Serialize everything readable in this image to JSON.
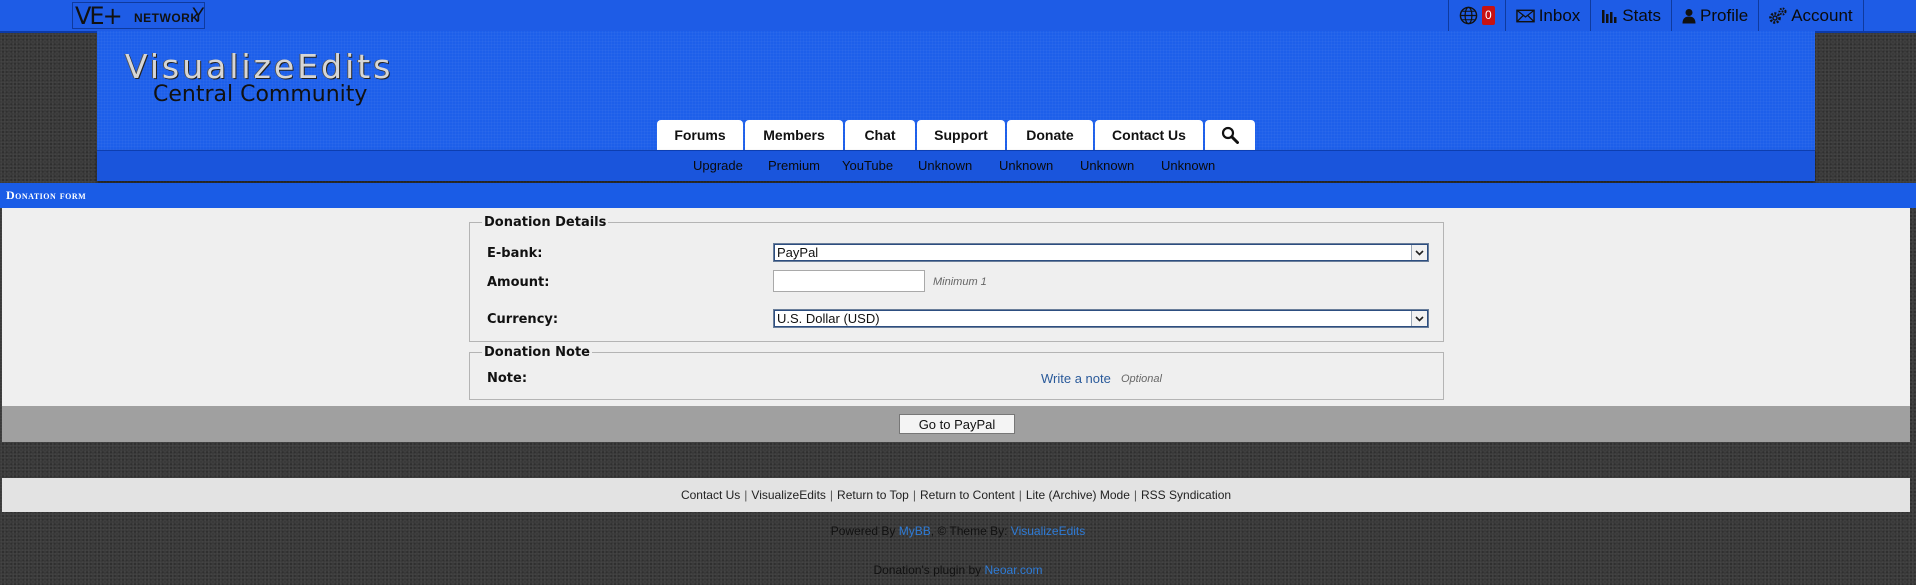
{
  "topbar": {
    "logo_mark": "VE+",
    "logo_network": "NETWORK",
    "logo_tail": "Y",
    "notification_count": "0",
    "inbox": "Inbox",
    "stats": "Stats",
    "profile": "Profile",
    "account": "Account"
  },
  "header": {
    "brand_title": "VisualizeEdits",
    "brand_subtitle": "Central Community"
  },
  "nav": {
    "items": [
      "Forums",
      "Members",
      "Chat",
      "Support",
      "Donate",
      "Contact Us"
    ]
  },
  "subnav": {
    "items": [
      "Upgrade",
      "Premium",
      "YouTube",
      "Unknown",
      "Unknown",
      "Unknown",
      "Unknown"
    ]
  },
  "page": {
    "title": "Donation form"
  },
  "donation_details": {
    "legend": "Donation Details",
    "ebank_label": "E-bank:",
    "ebank_value": "PayPal",
    "amount_label": "Amount:",
    "amount_value": "",
    "amount_hint": "Minimum 1",
    "currency_label": "Currency:",
    "currency_value": "U.S. Dollar (USD)"
  },
  "donation_note": {
    "legend": "Donation Note",
    "note_label": "Note:",
    "note_link": "Write a note",
    "note_optional": "Optional"
  },
  "submit": {
    "label": "Go to PayPal"
  },
  "footer": {
    "links": [
      "Contact Us",
      "VisualizeEdits",
      "Return to Top",
      "Return to Content",
      "Lite (Archive) Mode",
      "RSS Syndication"
    ],
    "powered_by": "Powered By",
    "mybb": "MyBB",
    "theme_by": ", © Theme By:",
    "theme_author": "VisualizeEdits",
    "plugin_by": "Donation's plugin by",
    "plugin_author": "Neoar.com"
  },
  "colors": {
    "brand_blue": "#1e5ce6",
    "badge_red": "#c81212",
    "link_blue": "#2e7bd6"
  }
}
